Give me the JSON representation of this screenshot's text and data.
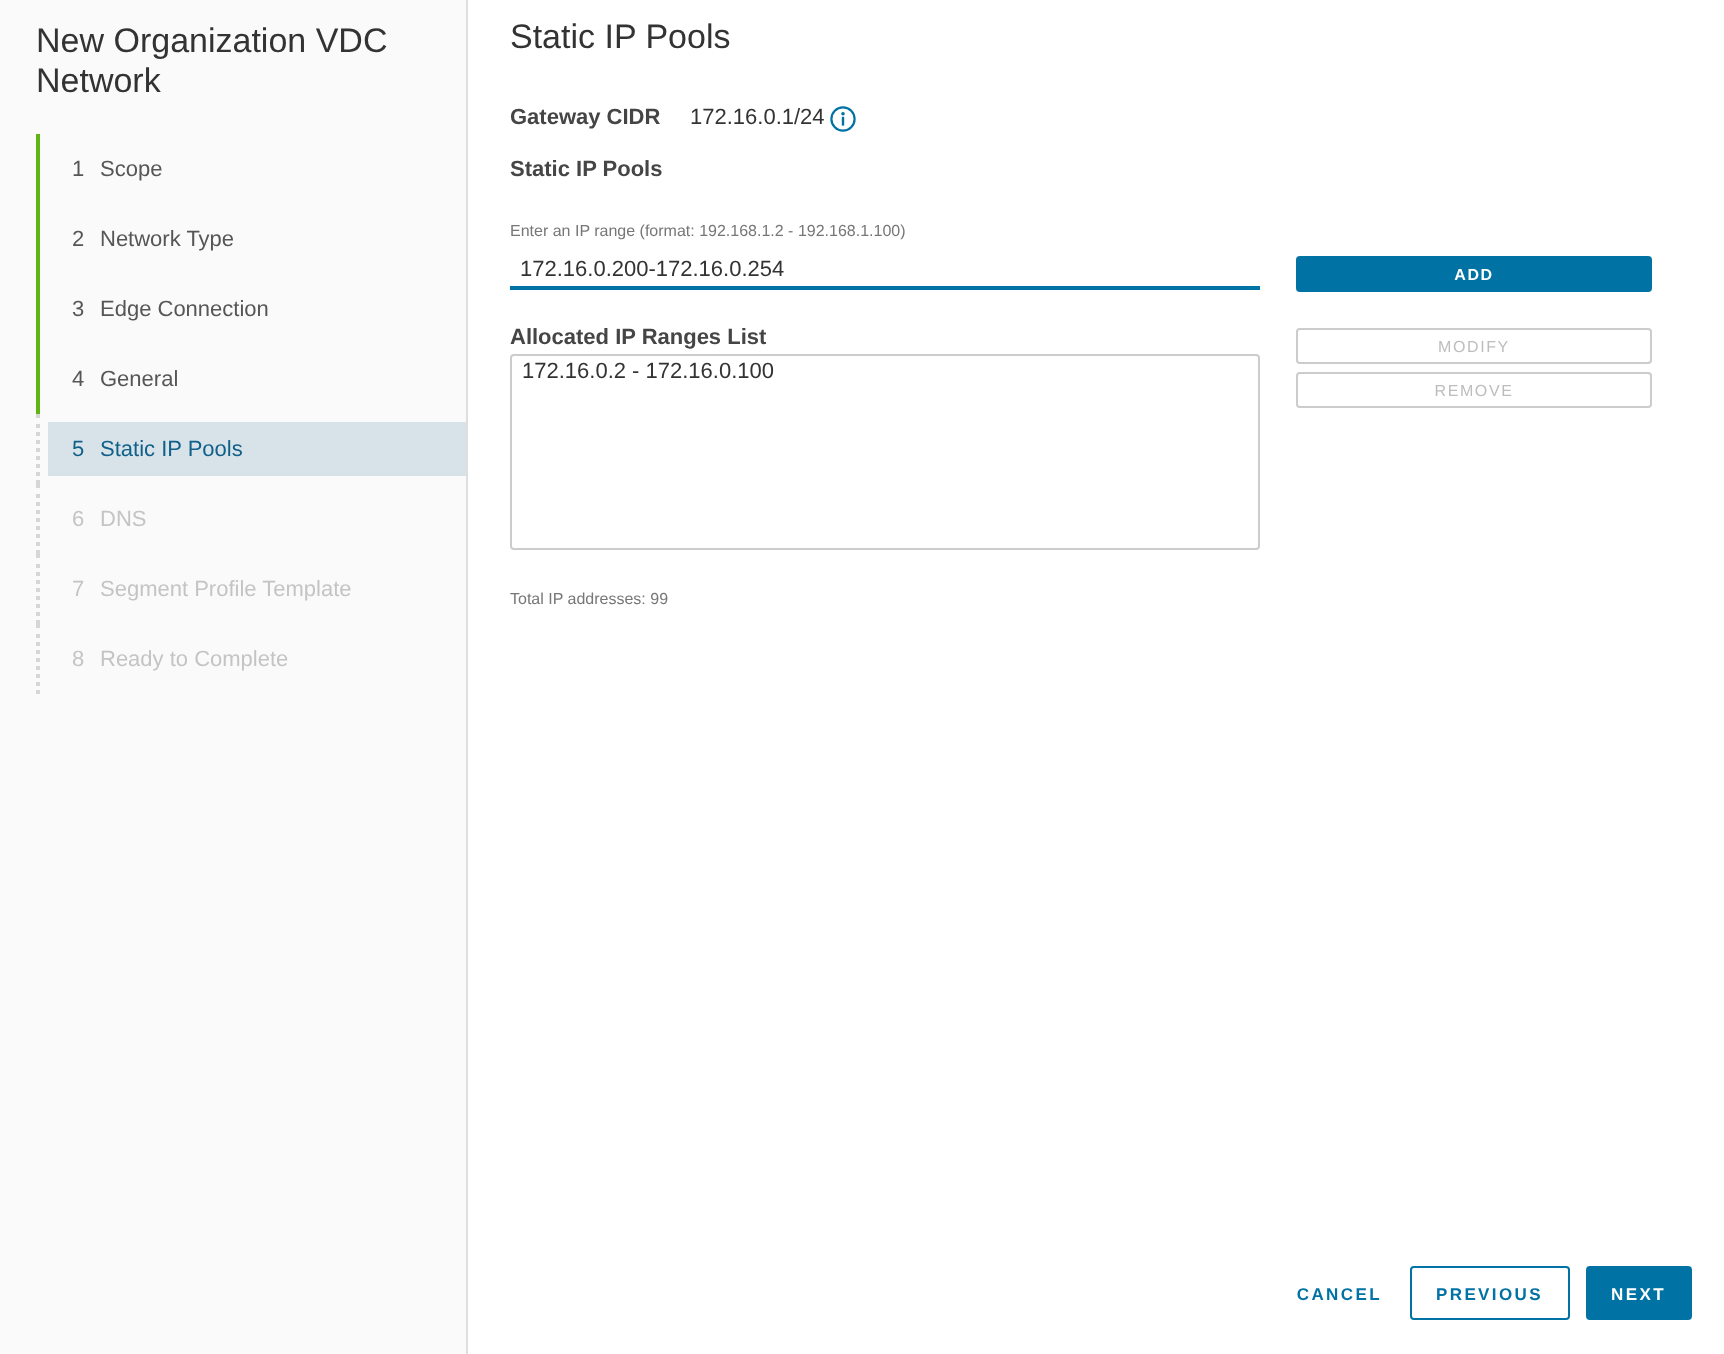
{
  "sidebar": {
    "title": "New Organization VDC Network",
    "steps": [
      {
        "number": "1",
        "label": "Scope",
        "completed": true,
        "selected": false,
        "disabled": false
      },
      {
        "number": "2",
        "label": "Network Type",
        "completed": true,
        "selected": false,
        "disabled": false
      },
      {
        "number": "3",
        "label": "Edge Connection",
        "completed": true,
        "selected": false,
        "disabled": false
      },
      {
        "number": "4",
        "label": "General",
        "completed": true,
        "selected": false,
        "disabled": false
      },
      {
        "number": "5",
        "label": "Static IP Pools",
        "completed": false,
        "selected": true,
        "disabled": false
      },
      {
        "number": "6",
        "label": "DNS",
        "completed": false,
        "selected": false,
        "disabled": true
      },
      {
        "number": "7",
        "label": "Segment Profile Template",
        "completed": false,
        "selected": false,
        "disabled": true
      },
      {
        "number": "8",
        "label": "Ready to Complete",
        "completed": false,
        "selected": false,
        "disabled": true
      }
    ]
  },
  "page": {
    "title": "Static IP Pools",
    "gateway": {
      "label": "Gateway CIDR",
      "value": "172.16.0.1/24"
    },
    "section_label": "Static IP Pools",
    "range_input": {
      "label": "Enter an IP range (format: 192.168.1.2 - 192.168.1.100)",
      "value": "172.16.0.200-172.16.0.254"
    },
    "buttons": [
      {
        "label": "ADD",
        "disabled": false
      },
      {
        "label": "MODIFY",
        "disabled": true
      },
      {
        "label": "REMOVE",
        "disabled": true
      }
    ],
    "list": {
      "label": "Allocated IP Ranges List",
      "items": [
        {
          "text": "172.16.0.2 - 172.16.0.100",
          "selected": false
        }
      ]
    },
    "total": "Total IP addresses: 99"
  },
  "footer": {
    "buttons": [
      {
        "label": "CANCEL",
        "kind": "link"
      },
      {
        "label": "PREVIOUS",
        "kind": "outline"
      },
      {
        "label": "NEXT",
        "kind": "primary"
      }
    ]
  }
}
